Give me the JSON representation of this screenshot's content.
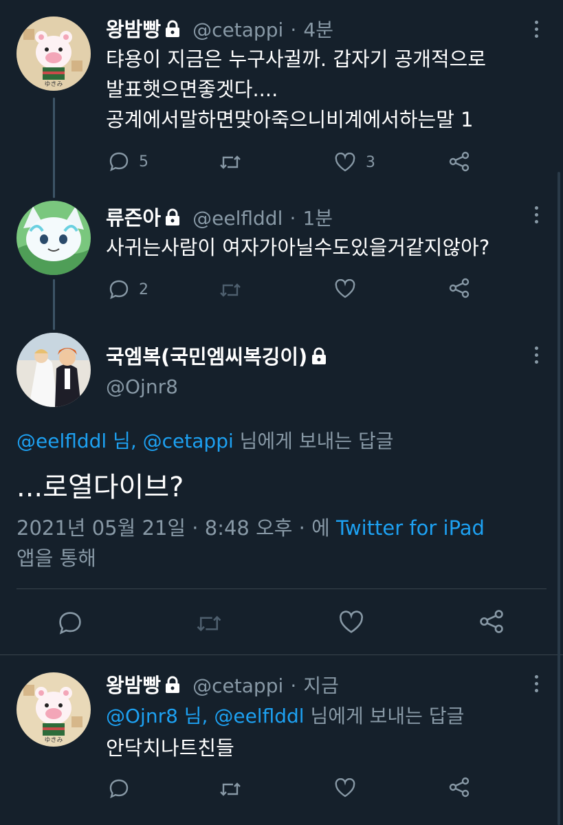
{
  "tweet1": {
    "name": "왕밤빵",
    "handle": "@cetappi",
    "time": "4분",
    "lines": [
      "탸용이 지금은 누구사귈까. 갑자기 공개적으로",
      "발표햇으면좋겟다....",
      "공계에서말하면맞아죽으니비계에서하는말 1"
    ],
    "reply_count": "5",
    "like_count": "3"
  },
  "tweet2": {
    "name": "류즌아",
    "handle": "@eelflddl",
    "time": "1분",
    "text": "사귀는사람이 여자가아닐수도있을거같지않아?",
    "reply_count": "2"
  },
  "main": {
    "name": "국엠복(국민엠씨복깅이)",
    "handle": "@Ojnr8",
    "reply_to_users": "@eelflddl 님, @cetappi",
    "reply_to_suffix": "님에게 보내는 답글",
    "text": "...로열다이브?",
    "timestamp": "2021년 05월 21일 · 8:48 오후 · 에",
    "via_app": "Twitter for iPad",
    "via_suffix": "앱을 통해"
  },
  "tweet4": {
    "name": "왕밤빵",
    "handle": "@cetappi",
    "time": "지금",
    "reply_to_users": "@Ojnr8 님, @eelflddl",
    "reply_to_suffix": "님에게 보내는 답글",
    "text": "안닥치나트친들"
  },
  "separator": "·",
  "icons": [
    "lock-icon",
    "reply-icon",
    "retweet-icon",
    "like-icon",
    "share-icon",
    "more-icon"
  ],
  "colors": {
    "background": "#15202b",
    "accent": "#1da1f2",
    "secondary": "#8899a6"
  }
}
